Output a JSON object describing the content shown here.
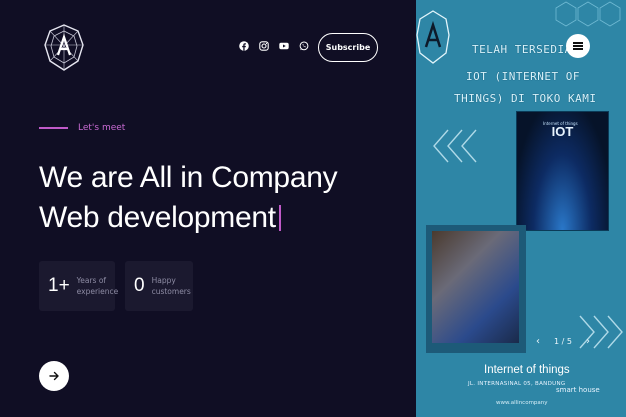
{
  "header": {
    "logo_name": "allin-logo",
    "socials": [
      "facebook",
      "instagram",
      "youtube",
      "whatsapp"
    ],
    "subscribe_label": "Subscribe"
  },
  "hero": {
    "eyebrow": "Let's meet",
    "headline_line1": "We are All in Company",
    "headline_line2": "Web development"
  },
  "stats": [
    {
      "number": "1+",
      "label_line1": "Years of",
      "label_line2": "experience"
    },
    {
      "number": "0",
      "label_line1": "Happy",
      "label_line2": "customers"
    }
  ],
  "cta": {
    "icon": "arrow-right-icon"
  },
  "banner": {
    "line1": "TELAH TERSEDIA",
    "line2": "IOT (INTERNET OF",
    "line3": "THINGS) DI TOKO KAMI",
    "iot_caption": "Internet of things",
    "iot_big": "IOT",
    "pager": "1 / 5",
    "caption_title": "Internet of things",
    "caption_address": "JL. INTERNASINAL 05, BANDUNG",
    "caption_sub": "smart house",
    "caption_url": "www.allincompany"
  },
  "colors": {
    "background": "#100e24",
    "accent": "#c05ac8",
    "banner": "#2e86a6"
  }
}
